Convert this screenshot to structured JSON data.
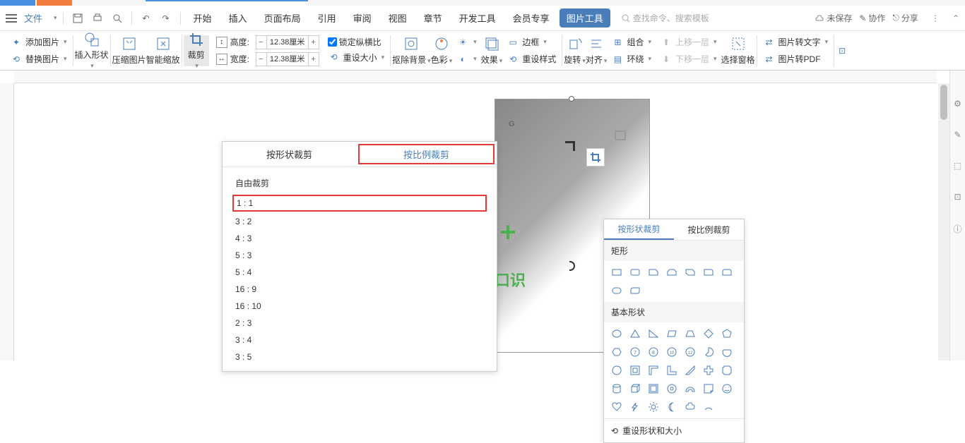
{
  "menubar": {
    "file": "文件",
    "items": [
      "开始",
      "插入",
      "页面布局",
      "引用",
      "审阅",
      "视图",
      "章节",
      "开发工具",
      "会员专享",
      "图片工具"
    ],
    "active_index": 9,
    "search_placeholder": "查找命令、搜索模板",
    "right": {
      "unsaved": "未保存",
      "collab": "协作",
      "share": "分享"
    }
  },
  "ribbon": {
    "add_image": "添加图片",
    "replace_image": "替换图片",
    "insert_shape": "插入形状",
    "compress_image": "压缩图片",
    "smart_resize": "智能缩放",
    "crop": "裁剪",
    "height_label": "高度:",
    "width_label": "宽度:",
    "height_value": "12.38厘米",
    "width_value": "12.38厘米",
    "lock_ratio": "锁定纵横比",
    "reset_size": "重设大小",
    "remove_bg": "抠除背景",
    "color": "色彩",
    "effect": "效果",
    "border": "边框",
    "reset_style": "重设样式",
    "rotate": "旋转",
    "align": "对齐",
    "group": "组合",
    "wrap": "环绕",
    "move_up": "上移一层",
    "move_down": "下移一层",
    "select_pane": "选择窗格",
    "pic_to_text": "图片转文字",
    "pic_to_pdf": "图片转PDF"
  },
  "crop_panel": {
    "tab_shape": "按形状裁剪",
    "tab_ratio": "按比例裁剪",
    "free_crop": "自由裁剪",
    "ratios": [
      "1 : 1",
      "3 : 2",
      "4 : 3",
      "5 : 3",
      "5 : 4",
      "16 : 9",
      "16 : 10",
      "2 : 3",
      "3 : 4",
      "3 : 5"
    ]
  },
  "shape_panel": {
    "tab_shape": "按形状裁剪",
    "tab_ratio": "按比例裁剪",
    "section_rect": "矩形",
    "section_basic": "基本形状",
    "reset": "重设形状和大小"
  },
  "doc": {
    "label_g": "G",
    "logo_text": "口识"
  }
}
